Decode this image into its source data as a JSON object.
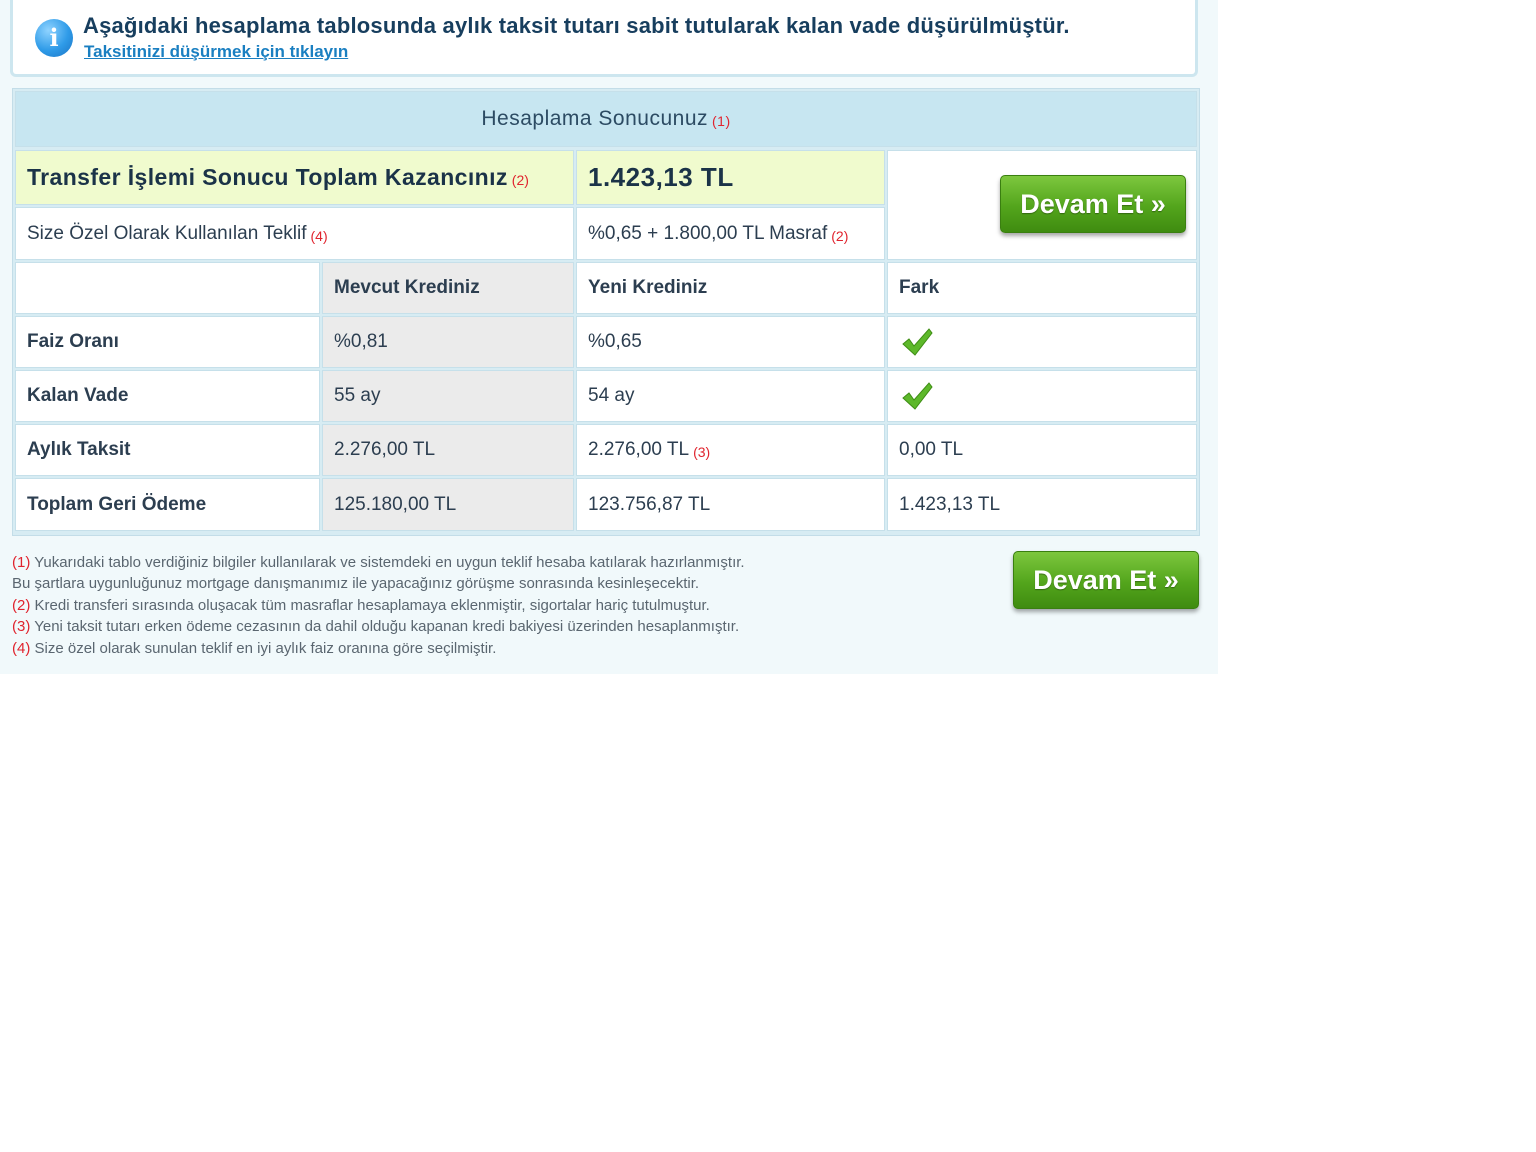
{
  "info": {
    "icon": "info-icon",
    "title": "Aşağıdaki hesaplama tablosunda aylık taksit tutarı sabit tutularak kalan vade düşürülmüştür.",
    "link": "Taksitinizi düşürmek için tıklayın"
  },
  "table": {
    "header": {
      "title": "Hesaplama Sonucunuz",
      "ref": "(1)"
    },
    "gain": {
      "label": "Transfer İşlemi Sonucu Toplam Kazancınız",
      "ref": "(2)",
      "value": "1.423,13 TL"
    },
    "offer": {
      "label": "Size Özel Olarak Kullanılan Teklif",
      "label_ref": "(4)",
      "value": "%0,65 + 1.800,00 TL Masraf",
      "value_ref": "(2)"
    },
    "columns": [
      "",
      "Mevcut Krediniz",
      "Yeni Krediniz",
      "Fark"
    ],
    "rows": [
      {
        "label": "Faiz Oranı",
        "current": "%0,81",
        "new": "%0,65",
        "new_ref": "",
        "diff": "",
        "diff_icon": "checkmark-icon"
      },
      {
        "label": "Kalan Vade",
        "current": "55 ay",
        "new": "54 ay",
        "new_ref": "",
        "diff": "",
        "diff_icon": "checkmark-icon"
      },
      {
        "label": "Aylık Taksit",
        "current": "2.276,00 TL",
        "new": "2.276,00 TL",
        "new_ref": "(3)",
        "diff": "0,00 TL",
        "diff_icon": ""
      },
      {
        "label": "Toplam Geri Ödeme",
        "current": "125.180,00 TL",
        "new": "123.756,87 TL",
        "new_ref": "",
        "diff": "1.423,13 TL",
        "diff_icon": ""
      }
    ]
  },
  "buttons": {
    "continue_top": "Devam Et »",
    "continue_bottom": "Devam Et »"
  },
  "footnotes": [
    {
      "num": "(1)",
      "text": " Yukarıdaki tablo verdiğiniz bilgiler kullanılarak ve sistemdeki en uygun teklif hesaba katılarak hazırlanmıştır."
    },
    {
      "num": "",
      "text": "Bu şartlara uygunluğunuz mortgage danışmanımız ile yapacağınız görüşme sonrasında kesinleşecektir."
    },
    {
      "num": "(2)",
      "text": " Kredi transferi sırasında oluşacak tüm masraflar hesaplamaya eklenmiştir, sigortalar hariç tutulmuştur."
    },
    {
      "num": "(3)",
      "text": " Yeni taksit tutarı erken ödeme cezasının da dahil olduğu kapanan kredi bakiyesi üzerinden hesaplanmıştır."
    },
    {
      "num": "(4)",
      "text": " Size özel olarak sunulan teklif en iyi aylık faiz oranına göre seçilmiştir."
    }
  ],
  "colors": {
    "accent_green": "#53a51c",
    "ref_red": "#e0242e",
    "header_blue": "#c7e6f1",
    "highlight_yellow": "#f0fbce"
  }
}
